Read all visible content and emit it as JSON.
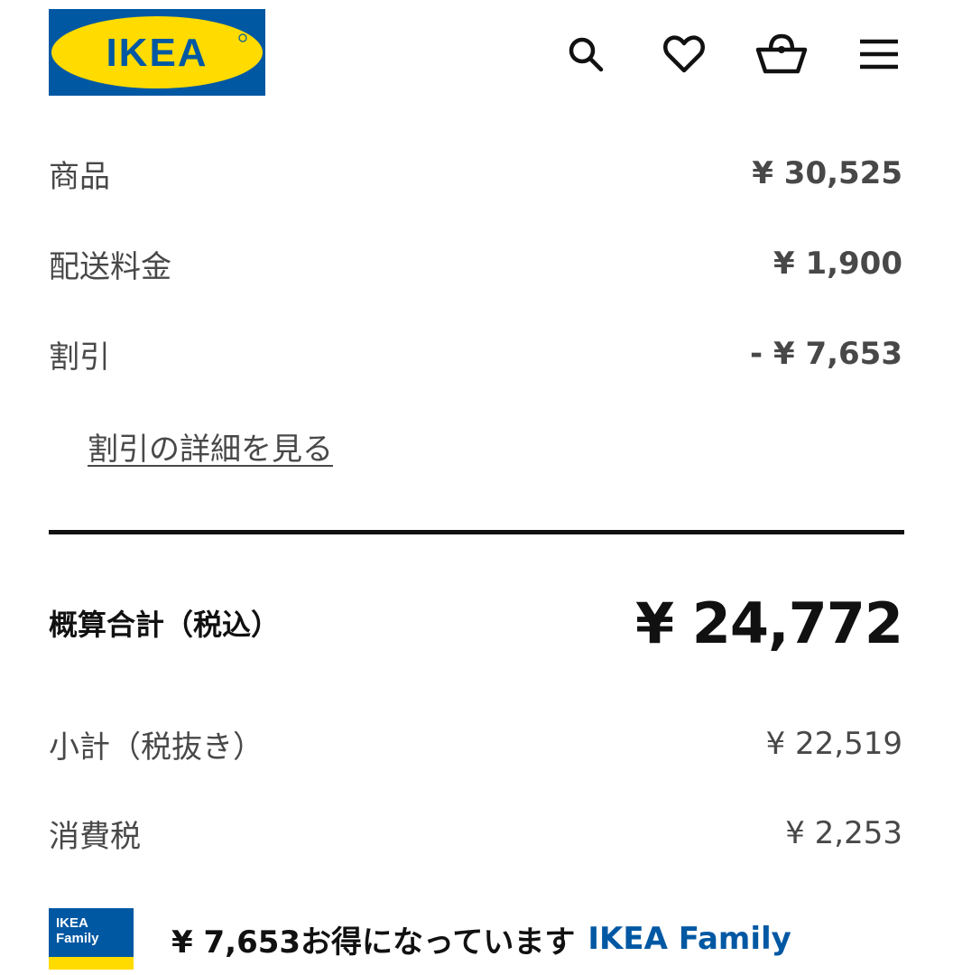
{
  "header": {
    "logo_text": "IKEA",
    "icons": [
      "search-icon",
      "heart-icon",
      "cart-icon",
      "menu-icon"
    ]
  },
  "summary": {
    "products_label": "商品",
    "products_value": "¥ 30,525",
    "shipping_label": "配送料金",
    "shipping_value": "¥ 1,900",
    "discount_label": "割引",
    "discount_value": "- ¥ 7,653",
    "discount_link": "割引の詳細を見る"
  },
  "total": {
    "label": "概算合計（税込）",
    "value": "¥ 24,772"
  },
  "breakdown": {
    "subtotal_label": "小計（税抜き）",
    "subtotal_value": "¥ 22,519",
    "tax_label": "消費税",
    "tax_value": "¥ 2,253"
  },
  "family": {
    "badge_line1": "IKEA",
    "badge_line2": "Family",
    "savings_text": "¥ 7,653お得になっています",
    "brand_text": "IKEA Family"
  },
  "colors": {
    "ikea_blue": "#0058a3",
    "ikea_yellow": "#ffdb00",
    "text_primary": "#111111",
    "text_secondary": "#484848"
  }
}
